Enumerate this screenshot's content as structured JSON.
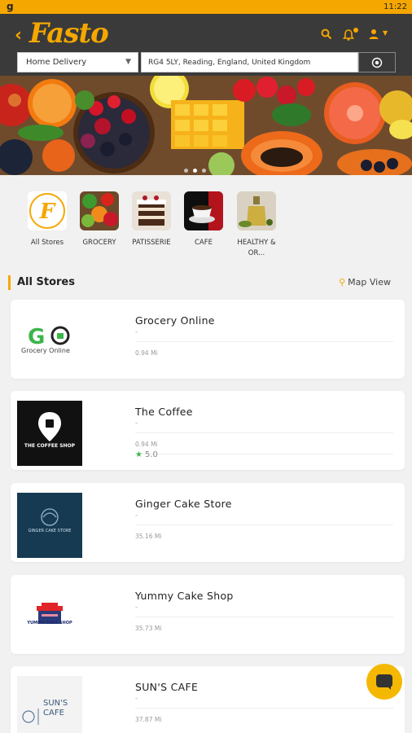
{
  "status_bar": {
    "carrier_glyph": "g",
    "time": "11:22"
  },
  "header": {
    "brand": "Fasto",
    "delivery_mode": "Home Delivery",
    "address": "RG4 5LY, Reading, England, United Kingdom",
    "icons": [
      "back-chevron-icon",
      "search-icon",
      "bell-icon",
      "user-icon",
      "caret-down-icon",
      "locate-icon"
    ]
  },
  "banner": {
    "slides": 3,
    "active_slide": 1
  },
  "categories": [
    {
      "label": "All Stores"
    },
    {
      "label": "GROCERY"
    },
    {
      "label": "PATISSERIE"
    },
    {
      "label": "CAFE"
    },
    {
      "label": "HEALTHY &\nOR..."
    }
  ],
  "section": {
    "title": "All Stores",
    "map_view": "Map View"
  },
  "stores": [
    {
      "name": "Grocery Online",
      "sub": "-",
      "distance": "0.94 Mi",
      "rating": "",
      "logo_text": "Grocery Online"
    },
    {
      "name": "The Coffee",
      "sub": "-",
      "distance": "0.94 Mi",
      "rating": "5.0",
      "logo_text": "THE COFFEE SHOP"
    },
    {
      "name": "Ginger Cake Store",
      "sub": "-",
      "distance": "35.16 Mi",
      "rating": "",
      "logo_text": "GINGER CAKE STORE"
    },
    {
      "name": "Yummy Cake Shop",
      "sub": "-",
      "distance": "35.73 Mi",
      "rating": "",
      "logo_text": "YUMMY CAKE SHOP"
    },
    {
      "name": "SUN'S CAFE",
      "sub": "-",
      "distance": "37.87 Mi",
      "rating": "",
      "logo_text": "SUN'S CAFE"
    }
  ],
  "colors": {
    "accent": "#f5a700",
    "header_bg": "#3a3a3a",
    "rating_star": "#3bb54a"
  }
}
